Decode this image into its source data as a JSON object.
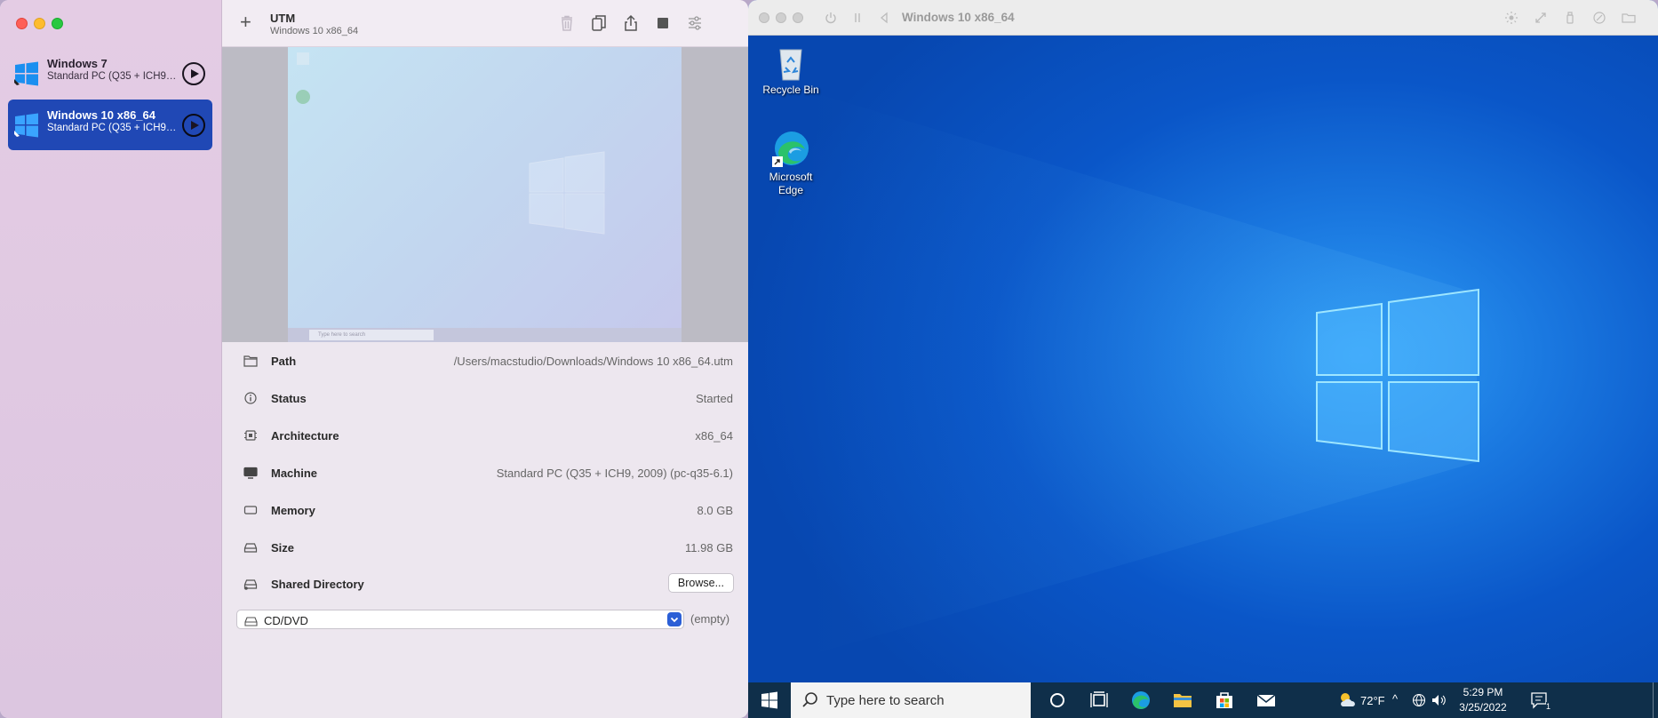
{
  "utm": {
    "sidebar": {
      "vms": [
        {
          "name": "Windows 7",
          "subtitle": "Standard PC (Q35 + ICH9, 2009)",
          "selected": false
        },
        {
          "name": "Windows 10 x86_64",
          "subtitle": "Standard PC (Q35 + ICH9, 2009)",
          "selected": true
        }
      ]
    },
    "toolbar": {
      "title": "UTM",
      "subtitle": "Windows 10 x86_64",
      "icons": [
        "plus-icon",
        "trash-icon",
        "clone-icon",
        "share-icon",
        "stop-icon",
        "settings-icon"
      ]
    },
    "preview": {
      "search_placeholder": "Type here to search"
    },
    "details": {
      "rows": [
        {
          "label": "Path",
          "value": "/Users/macstudio/Downloads/Windows 10 x86_64.utm",
          "icon": "folder-icon"
        },
        {
          "label": "Status",
          "value": "Started",
          "icon": "info-icon"
        },
        {
          "label": "Architecture",
          "value": "x86_64",
          "icon": "cpu-icon"
        },
        {
          "label": "Machine",
          "value": "Standard PC (Q35 + ICH9, 2009) (pc-q35-6.1)",
          "icon": "display-icon"
        },
        {
          "label": "Memory",
          "value": "8.0 GB",
          "icon": "memory-icon"
        },
        {
          "label": "Size",
          "value": "11.98 GB",
          "icon": "drive-icon"
        },
        {
          "label": "Shared Directory",
          "value": "",
          "icon": "shared-drive-icon"
        }
      ],
      "browse_label": "Browse...",
      "cd_label": "CD/DVD",
      "cd_value": "(empty)"
    }
  },
  "vm_window": {
    "title": "Windows 10 x86_64",
    "desktop_icons": [
      {
        "label": "Recycle Bin"
      },
      {
        "label": "Microsoft Edge"
      }
    ],
    "taskbar": {
      "search_placeholder": "Type here to search",
      "weather": "72°F",
      "time": "5:29 PM",
      "date": "3/25/2022",
      "notification_count": "1"
    }
  },
  "colors": {
    "selection": "#2048b5",
    "desktop_blue": "#0a56c8",
    "taskbar": "#0f2f4a"
  }
}
